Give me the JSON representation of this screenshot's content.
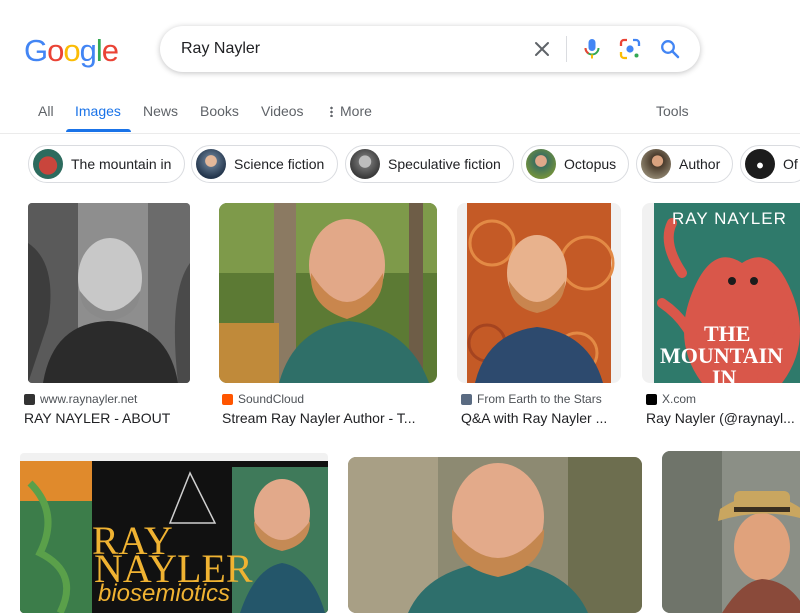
{
  "logo": {
    "letters": [
      "G",
      "o",
      "o",
      "g",
      "l",
      "e"
    ],
    "colors": [
      "#4285F4",
      "#EA4335",
      "#FBBC05",
      "#4285F4",
      "#34A853",
      "#EA4335"
    ]
  },
  "search": {
    "query": "Ray Nayler"
  },
  "icons": {
    "clear": "close-icon",
    "voice": "microphone-icon",
    "lens": "lens-icon",
    "search": "search-icon"
  },
  "tabs": [
    {
      "label": "All"
    },
    {
      "label": "Images",
      "active": true
    },
    {
      "label": "News"
    },
    {
      "label": "Books"
    },
    {
      "label": "Videos"
    },
    {
      "label": "More"
    }
  ],
  "tools_label": "Tools",
  "chips": [
    {
      "label": "The mountain in"
    },
    {
      "label": "Science fiction"
    },
    {
      "label": "Speculative fiction"
    },
    {
      "label": "Octopus"
    },
    {
      "label": "Author"
    },
    {
      "label": "Of"
    }
  ],
  "results": [
    {
      "source": "www.raynayler.net",
      "title": "RAY NAYLER - ABOUT"
    },
    {
      "source": "SoundCloud",
      "title": "Stream Ray Nayler Author - T..."
    },
    {
      "source": "From Earth to the Stars",
      "title": "Q&A with Ray Nayler ..."
    },
    {
      "source": "X.com",
      "title": "Ray Nayler (@raynayl..."
    }
  ],
  "image_text": {
    "book_author": "RAY NAYLER",
    "book_title_1": "THE",
    "book_title_2": "MOUNTAIN",
    "book_title_3": "IN",
    "poster_line_1": "RAY",
    "poster_line_2": "NAYLER",
    "poster_line_3": "biosemiotics"
  },
  "colors": {
    "accent": "#1a73e8",
    "text_secondary": "#5f6368",
    "chip_border": "#dadce0"
  }
}
